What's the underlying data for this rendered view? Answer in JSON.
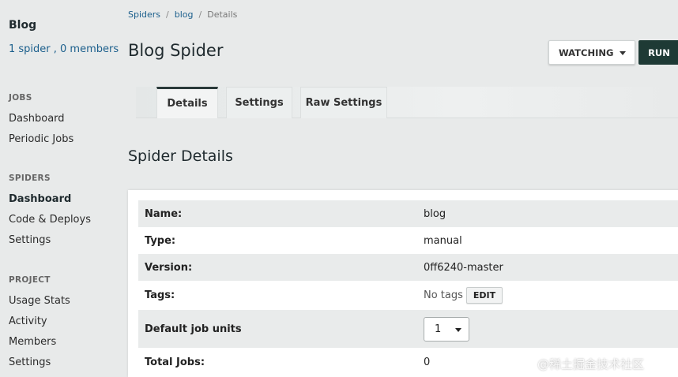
{
  "sidebar": {
    "project_title": "Blog",
    "project_meta": "1 spider , 0 members",
    "sections": [
      {
        "heading": "JOBS",
        "items": [
          {
            "label": "Dashboard"
          },
          {
            "label": "Periodic Jobs"
          }
        ]
      },
      {
        "heading": "SPIDERS",
        "items": [
          {
            "label": "Dashboard"
          },
          {
            "label": "Code & Deploys"
          },
          {
            "label": "Settings"
          }
        ]
      },
      {
        "heading": "PROJECT",
        "items": [
          {
            "label": "Usage Stats"
          },
          {
            "label": "Activity"
          },
          {
            "label": "Members"
          },
          {
            "label": "Settings"
          }
        ]
      }
    ]
  },
  "breadcrumb": {
    "items": [
      "Spiders",
      "blog",
      "Details"
    ],
    "separator": "/"
  },
  "header": {
    "title": "Blog Spider",
    "watch_label": "WATCHING",
    "run_label": "RUN"
  },
  "tabs": [
    "Details",
    "Settings",
    "Raw Settings"
  ],
  "details": {
    "section_title": "Spider Details",
    "rows": [
      {
        "label": "Name:",
        "value": "blog"
      },
      {
        "label": "Type:",
        "value": "manual"
      },
      {
        "label": "Version:",
        "value": "0ff6240-master"
      },
      {
        "label": "Tags:",
        "value": "No tags",
        "edit_label": "EDIT"
      },
      {
        "label": "Default job units",
        "value": "1"
      },
      {
        "label": "Total Jobs:",
        "value": "0"
      }
    ]
  },
  "watermark": "@稀土掘金技术社区",
  "colors": {
    "link": "#1b5f8c",
    "run_button": "#1e3a35",
    "background": "#e8eaea"
  }
}
